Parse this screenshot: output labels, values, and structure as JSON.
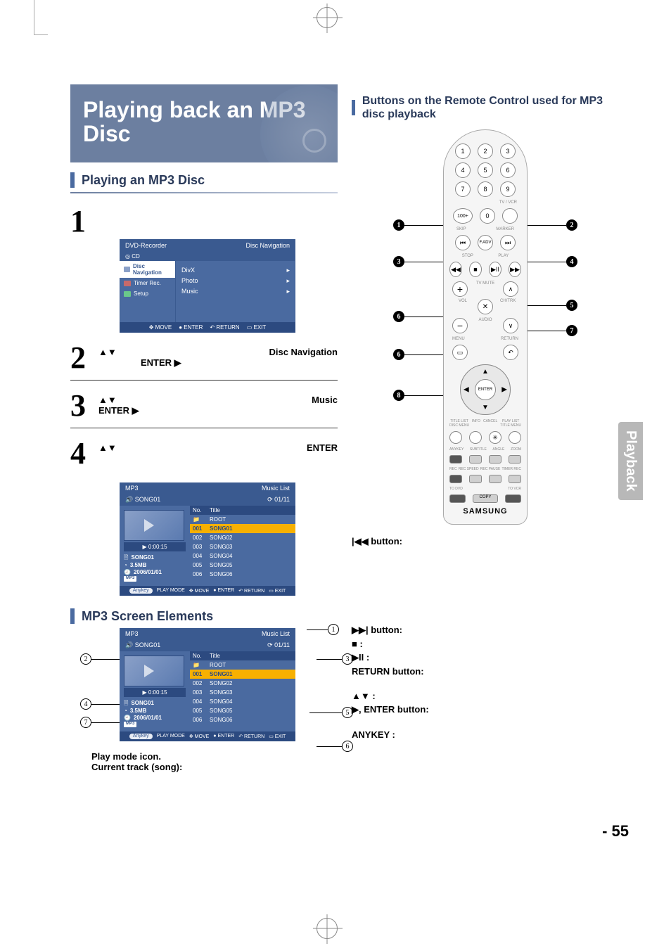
{
  "page": {
    "title_line1": "Playing back an MP3",
    "title_line2": "Disc",
    "section1": "Playing an MP3 Disc",
    "section2": "MP3 Screen Elements",
    "section3": "Buttons on the Remote Control used for MP3 disc playback",
    "side_tab": "Playback",
    "page_num": "- 55"
  },
  "steps": {
    "s2_a": "▲▼",
    "s2_b": "Disc Navigation",
    "s2_c": "ENTER    ▶",
    "s3_a": "▲▼",
    "s3_b": "Music",
    "s3_c": "ENTER    ▶",
    "s4_a": "▲▼",
    "s4_b": "ENTER"
  },
  "osd": {
    "title_left": "DVD-Recorder",
    "title_right": "Disc Navigation",
    "cd": "CD",
    "side": [
      {
        "icon": "nav",
        "label": "Disc Navigation",
        "sel": true
      },
      {
        "icon": "timer",
        "label": "Timer Rec.",
        "sel": false
      },
      {
        "icon": "setup",
        "label": "Setup",
        "sel": false
      }
    ],
    "main": [
      "DivX",
      "Photo",
      "Music"
    ],
    "foot": {
      "move": "MOVE",
      "enter": "ENTER",
      "return": "RETURN",
      "exit": "EXIT"
    }
  },
  "mlist": {
    "head_l": "MP3",
    "head_r": "Music List",
    "sub_l_icon": "speaker",
    "sub_l": "SONG01",
    "sub_r": "01/11",
    "time": "▶ 0:00:15",
    "info_name": "SONG01",
    "info_size": "3.5MB",
    "info_date": "2006/01/01",
    "info_type": "MP3",
    "hdr_no": "No.",
    "hdr_title": "Title",
    "tracks": [
      {
        "no": "",
        "title": "ROOT",
        "root": true
      },
      {
        "no": "001",
        "title": "SONG01",
        "sel": true
      },
      {
        "no": "002",
        "title": "SONG02"
      },
      {
        "no": "003",
        "title": "SONG03"
      },
      {
        "no": "004",
        "title": "SONG04"
      },
      {
        "no": "005",
        "title": "SONG05"
      },
      {
        "no": "006",
        "title": "SONG06"
      }
    ],
    "foot": {
      "anykey": "Anykey",
      "pm": "PLAY MODE",
      "move": "MOVE",
      "enter": "ENTER",
      "return": "RETURN",
      "exit": "EXIT"
    }
  },
  "right_text": {
    "skipback_label": "|◀◀ button:",
    "skipfwd_label": "▶▶| button:",
    "stop_label": "■ :",
    "playpause_label": "▶II :",
    "return_label": "RETURN button:",
    "updown_label": "▲▼ :",
    "enter_label": "▶, ENTER button:",
    "anykey_label": "ANYKEY :"
  },
  "caption": {
    "l1": "Play mode icon.",
    "l2": "Current track (song):"
  },
  "remote": {
    "brand": "SAMSUNG",
    "tiny": {
      "tvvcr": "TV / VCR",
      "skip": "SKIP",
      "marker": "MARKER",
      "stop": "STOP",
      "play": "PLAY",
      "adv": "F.ADV",
      "tvmute": "TV MUTE",
      "vol": "VOL",
      "chtrk": "CH/TRK",
      "audio": "AUDIO",
      "menu": "MENU",
      "return": "RETURN",
      "enter": "ENTER",
      "titlelist": "TITLE LIST\nDISC MENU",
      "info": "INFO",
      "cancel": "CANCEL",
      "playlist": "PLAY LIST\nTITLE MENU",
      "anykey": "ANYKEY",
      "subtitle": "SUBTITLE",
      "angle": "ANGLE",
      "zoom": "ZOOM",
      "rec": "REC",
      "recspeed": "REC SPEED",
      "recpause": "REC PAUSE",
      "timerrec": "TIMER REC",
      "todvd": "TO DVD",
      "tovcr": "TO VCR",
      "copy": "COPY",
      "hundred": "100+"
    }
  },
  "chart_data": null
}
